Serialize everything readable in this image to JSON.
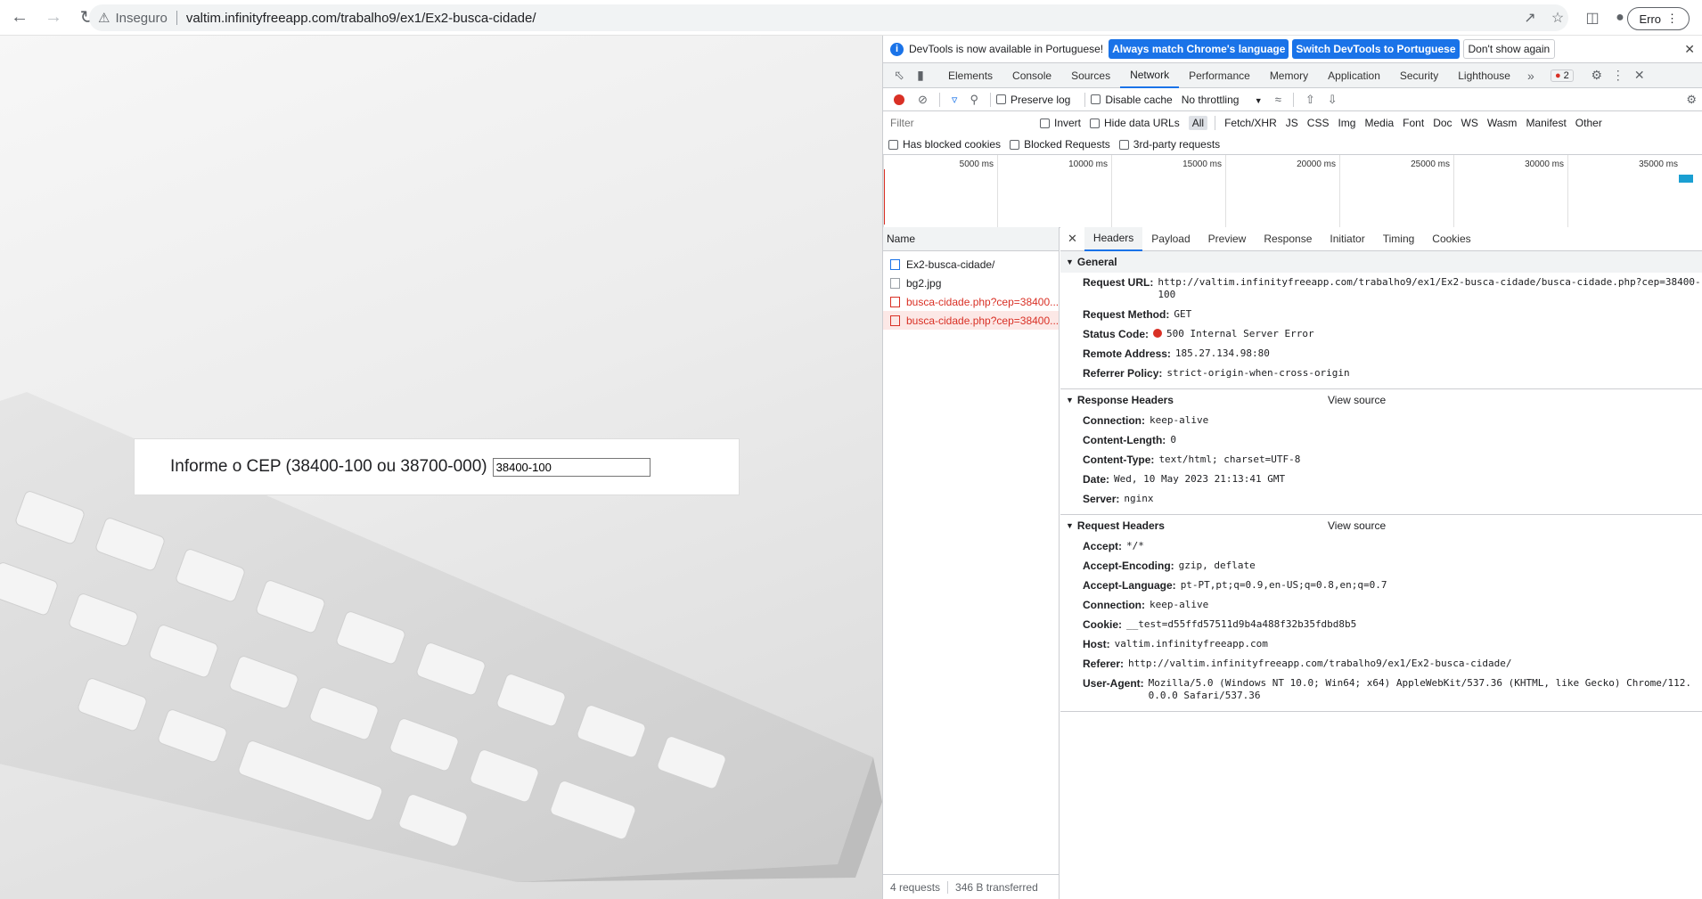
{
  "browser": {
    "security_label": "Inseguro",
    "url": "valtim.infinityfreeapp.com/trabalho9/ex1/Ex2-busca-cidade/",
    "profile_button": "Erro"
  },
  "page": {
    "cep_label": "Informe o CEP (38400-100 ou 38700-000)",
    "cep_value": "38400-100"
  },
  "devtools": {
    "infobar": {
      "message": "DevTools is now available in Portuguese!",
      "btn_match": "Always match Chrome's language",
      "btn_switch": "Switch DevTools to Portuguese",
      "btn_dont": "Don't show again"
    },
    "tabs": [
      "Elements",
      "Console",
      "Sources",
      "Network",
      "Performance",
      "Memory",
      "Application",
      "Security",
      "Lighthouse"
    ],
    "error_count": "2",
    "toolbar": {
      "preserve_log": "Preserve log",
      "disable_cache": "Disable cache",
      "throttling": "No throttling"
    },
    "filter": {
      "placeholder": "Filter",
      "invert": "Invert",
      "hide_data_urls": "Hide data URLs",
      "types": [
        "All",
        "Fetch/XHR",
        "JS",
        "CSS",
        "Img",
        "Media",
        "Font",
        "Doc",
        "WS",
        "Wasm",
        "Manifest",
        "Other"
      ],
      "has_blocked_cookies": "Has blocked cookies",
      "blocked_requests": "Blocked Requests",
      "third_party": "3rd-party requests"
    },
    "timeline_ticks": [
      "5000 ms",
      "10000 ms",
      "15000 ms",
      "20000 ms",
      "25000 ms",
      "30000 ms",
      "35000 ms"
    ],
    "name_header": "Name",
    "requests": [
      {
        "name": "Ex2-busca-cidade/"
      },
      {
        "name": "bg2.jpg"
      },
      {
        "name": "busca-cidade.php?cep=38400..."
      },
      {
        "name": "busca-cidade.php?cep=38400..."
      }
    ],
    "status": {
      "requests": "4 requests",
      "transferred": "346 B transferred"
    },
    "detail_tabs": [
      "Headers",
      "Payload",
      "Preview",
      "Response",
      "Initiator",
      "Timing",
      "Cookies"
    ],
    "general": {
      "title": "General",
      "rows": [
        {
          "k": "Request URL:",
          "v": "http://valtim.infinityfreeapp.com/trabalho9/ex1/Ex2-busca-cidade/busca-cidade.php?cep=38400-100"
        },
        {
          "k": "Request Method:",
          "v": "GET"
        },
        {
          "k": "Status Code:",
          "v": "500 Internal Server Error"
        },
        {
          "k": "Remote Address:",
          "v": "185.27.134.98:80"
        },
        {
          "k": "Referrer Policy:",
          "v": "strict-origin-when-cross-origin"
        }
      ]
    },
    "response_headers": {
      "title": "Response Headers",
      "view_source": "View source",
      "rows": [
        {
          "k": "Connection:",
          "v": "keep-alive"
        },
        {
          "k": "Content-Length:",
          "v": "0"
        },
        {
          "k": "Content-Type:",
          "v": "text/html; charset=UTF-8"
        },
        {
          "k": "Date:",
          "v": "Wed, 10 May 2023 21:13:41 GMT"
        },
        {
          "k": "Server:",
          "v": "nginx"
        }
      ]
    },
    "request_headers": {
      "title": "Request Headers",
      "view_source": "View source",
      "rows": [
        {
          "k": "Accept:",
          "v": "*/*"
        },
        {
          "k": "Accept-Encoding:",
          "v": "gzip, deflate"
        },
        {
          "k": "Accept-Language:",
          "v": "pt-PT,pt;q=0.9,en-US;q=0.8,en;q=0.7"
        },
        {
          "k": "Connection:",
          "v": "keep-alive"
        },
        {
          "k": "Cookie:",
          "v": "__test=d55ffd57511d9b4a488f32b35fdbd8b5"
        },
        {
          "k": "Host:",
          "v": "valtim.infinityfreeapp.com"
        },
        {
          "k": "Referer:",
          "v": "http://valtim.infinityfreeapp.com/trabalho9/ex1/Ex2-busca-cidade/"
        },
        {
          "k": "User-Agent:",
          "v": "Mozilla/5.0 (Windows NT 10.0; Win64; x64) AppleWebKit/537.36 (KHTML, like Gecko) Chrome/112.0.0.0 Safari/537.36"
        }
      ]
    }
  }
}
